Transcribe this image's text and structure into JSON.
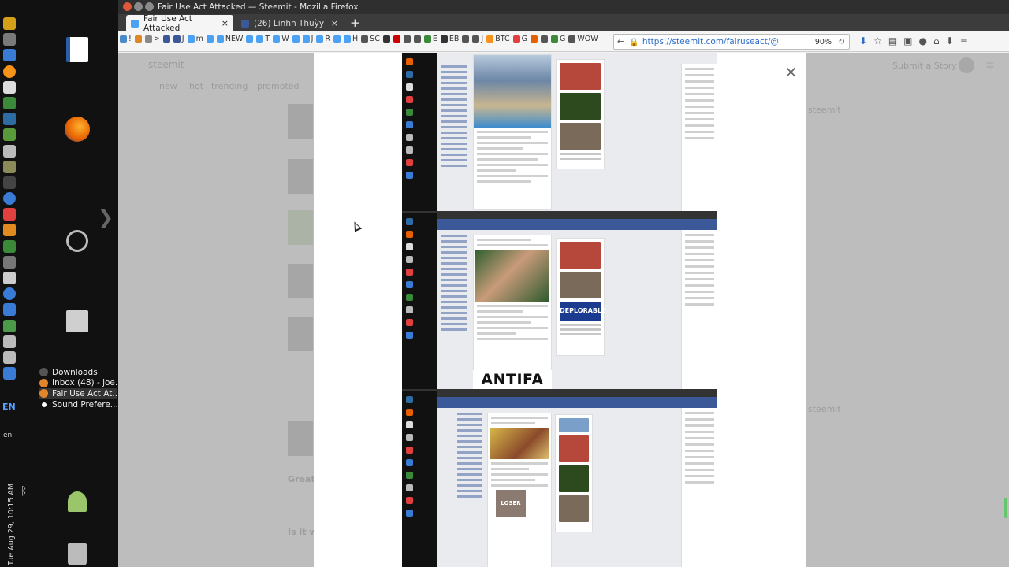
{
  "window": {
    "title": "Fair Use Act Attacked — Steemit - Mozilla Firefox"
  },
  "tabs": [
    {
      "label": "Fair Use Act Attacked",
      "active": true,
      "close": "×"
    },
    {
      "label": "(26) Linhh Thuỳy",
      "active": false,
      "close": "×"
    }
  ],
  "newtab": "+",
  "bookmarks": [
    "!",
    "",
    ">",
    "",
    "J",
    "m",
    "",
    "NEW",
    "",
    "T",
    "W",
    "",
    "J",
    "R",
    "",
    "H",
    "SC",
    "",
    "",
    "",
    "",
    "E",
    "EB",
    "",
    "J",
    "BTC",
    "G",
    "",
    "",
    "G",
    "WOW"
  ],
  "address": {
    "back": "←",
    "lock": "🔒",
    "url": "https://steemit.com/fairuseact/@",
    "zoom": "90%",
    "reload": "↻"
  },
  "toolbar_icons": [
    "download-icon",
    "star-icon",
    "library-icon",
    "sync-icon",
    "steemit-icon",
    "home-icon",
    "pocket-icon",
    "menu-icon"
  ],
  "toolbar_glyphs": [
    "⬇",
    "☆",
    "▤",
    "▣",
    "●",
    "⌂",
    "⬇",
    "≡"
  ],
  "steemit_ghost": {
    "logo": "steemit",
    "submit": "Submit a Story",
    "nav": [
      "new",
      "hot",
      "trending",
      "promoted"
    ],
    "side_words": [
      "steemit",
      "steemit"
    ],
    "comment_1": "Great v",
    "comment_2": "Is it wo"
  },
  "modal": {
    "close": "×",
    "antifa_text": "ANTIFA",
    "deplorable_text": "DEPLORABLE",
    "loser_text": "LOSER"
  },
  "launcher": {
    "lang": "EN",
    "lang_small": "en",
    "clock": "Tue Aug 29, 10:15 AM",
    "arrow": "❯"
  },
  "taskmenu": [
    {
      "label": "Downloads",
      "color": "#555"
    },
    {
      "label": "Inbox (48) - joe...",
      "color": "#e0852a"
    },
    {
      "label": "Fair Use Act At...",
      "color": "#e0852a"
    },
    {
      "label": "Sound Prefere...",
      "color": "#fff"
    }
  ],
  "colors": {
    "accent_green": "#63c76b",
    "firefox_orange": "#e66000",
    "facebook_blue": "#3b5998"
  }
}
